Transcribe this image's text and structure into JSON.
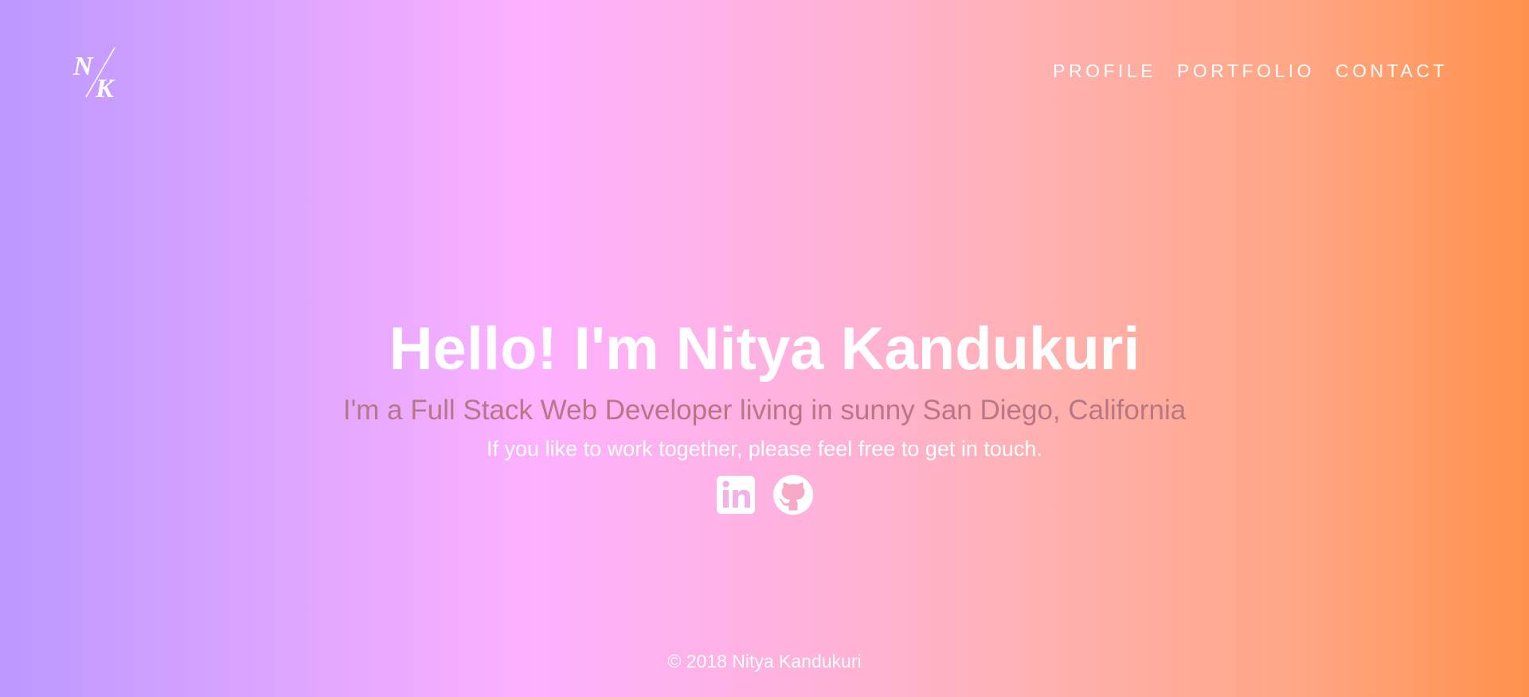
{
  "logo": {
    "text": "N/K",
    "icon": "nk-monogram-logo"
  },
  "nav": {
    "items": [
      {
        "label": "PROFILE"
      },
      {
        "label": "PORTFOLIO"
      },
      {
        "label": "CONTACT"
      }
    ]
  },
  "hero": {
    "heading": "Hello! I'm Nitya Kandukuri",
    "tagline": "I'm a Full Stack Web Developer living in sunny San Diego, California",
    "cta": "If you like to work together, please feel free to get in touch."
  },
  "social": {
    "links": [
      {
        "icon": "linkedin-icon"
      },
      {
        "icon": "github-icon"
      }
    ]
  },
  "footer": {
    "text": "© 2018 Nitya Kandukuri"
  },
  "colors": {
    "gradient_start": "#bb98ff",
    "gradient_mid": "#fdb1ff",
    "gradient_end": "#ff914b",
    "tagline": "#b97785",
    "text": "#ffffff"
  }
}
